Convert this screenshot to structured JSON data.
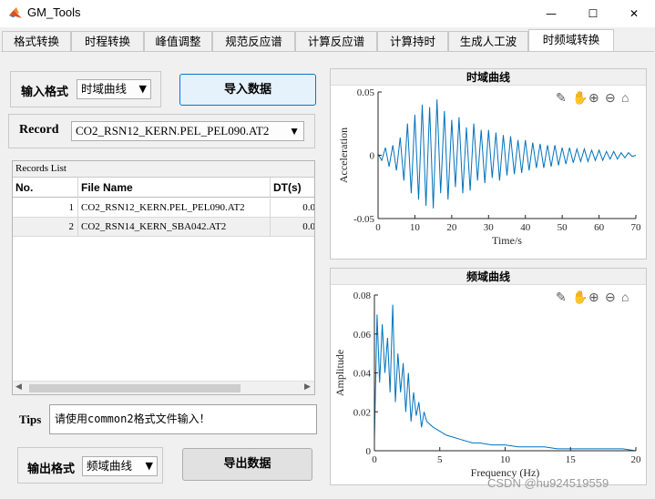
{
  "window": {
    "title": "GM_Tools",
    "controls": {
      "minimize": "—",
      "maximize": "☐",
      "close": "✕"
    }
  },
  "tabs": [
    {
      "label": "格式转换",
      "active": false
    },
    {
      "label": "时程转换",
      "active": false
    },
    {
      "label": "峰值调整",
      "active": false
    },
    {
      "label": "规范反应谱",
      "active": false
    },
    {
      "label": "计算反应谱",
      "active": false
    },
    {
      "label": "计算持时",
      "active": false
    },
    {
      "label": "生成人工波",
      "active": false
    },
    {
      "label": "时频域转换",
      "active": true
    }
  ],
  "left": {
    "input_format_label": "输入格式",
    "input_format_value": "时域曲线",
    "import_button": "导入数据",
    "record_label": "Record",
    "record_value": "CO2_RSN12_KERN.PEL_PEL090.AT2",
    "records_list_title": "Records List",
    "columns": [
      "No.",
      "File Name",
      "DT(s)"
    ],
    "rows": [
      {
        "no": "1",
        "file": "CO2_RSN12_KERN.PEL_PEL090.AT2",
        "dt": "0.0"
      },
      {
        "no": "2",
        "file": "CO2_RSN14_KERN_SBA042.AT2",
        "dt": "0.0"
      }
    ],
    "tips_label": "Tips",
    "tips_value": "请使用common2格式文件输入！",
    "output_format_label": "输出格式",
    "output_format_value": "频域曲线",
    "export_button": "导出数据"
  },
  "time_plot": {
    "panel_title": "时域曲线",
    "chart_data": {
      "type": "line",
      "xlabel": "Time/s",
      "ylabel": "Acceleration",
      "xlim": [
        0,
        70
      ],
      "ylim": [
        -0.05,
        0.05
      ],
      "xticks": [
        "0",
        "10",
        "20",
        "30",
        "40",
        "50",
        "60",
        "70"
      ],
      "yticks": [
        "-0.05",
        "0",
        "0.05"
      ],
      "series_color": "#0072bd",
      "x": [
        0,
        1,
        2,
        3,
        4,
        5,
        6,
        7,
        8,
        9,
        10,
        11,
        12,
        13,
        14,
        15,
        16,
        17,
        18,
        19,
        20,
        21,
        22,
        23,
        24,
        25,
        26,
        27,
        28,
        29,
        30,
        31,
        32,
        33,
        34,
        35,
        36,
        37,
        38,
        39,
        40,
        41,
        42,
        43,
        44,
        45,
        46,
        47,
        48,
        49,
        50,
        51,
        52,
        53,
        54,
        55,
        56,
        57,
        58,
        59,
        60,
        61,
        62,
        63,
        64,
        65,
        66,
        67,
        68,
        69,
        70
      ],
      "y": [
        0.001,
        -0.004,
        0.006,
        -0.009,
        0.008,
        -0.012,
        0.014,
        -0.02,
        0.025,
        -0.03,
        0.032,
        -0.035,
        0.04,
        -0.04,
        0.038,
        -0.042,
        0.044,
        -0.03,
        0.035,
        -0.035,
        0.028,
        -0.025,
        0.03,
        -0.03,
        0.022,
        -0.028,
        0.025,
        -0.02,
        0.02,
        -0.022,
        0.02,
        -0.018,
        0.018,
        -0.02,
        0.016,
        -0.016,
        0.015,
        -0.015,
        0.012,
        -0.014,
        0.012,
        -0.012,
        0.01,
        -0.01,
        0.009,
        -0.01,
        0.008,
        -0.009,
        0.008,
        -0.008,
        0.006,
        -0.007,
        0.006,
        -0.006,
        0.005,
        -0.005,
        0.005,
        -0.005,
        0.004,
        -0.004,
        0.004,
        -0.004,
        0.003,
        -0.003,
        0.003,
        -0.003,
        0.002,
        -0.002,
        0.002,
        -0.001,
        0.0
      ]
    }
  },
  "freq_plot": {
    "panel_title": "频域曲线",
    "chart_data": {
      "type": "line",
      "xlabel": "Frequency (Hz)",
      "ylabel": "Amplitude",
      "xlim": [
        0,
        20
      ],
      "ylim": [
        0,
        0.08
      ],
      "xticks": [
        "0",
        "5",
        "10",
        "15",
        "20"
      ],
      "yticks": [
        "0",
        "0.02",
        "0.04",
        "0.06",
        "0.08"
      ],
      "series_color": "#0072bd",
      "x": [
        0,
        0.2,
        0.4,
        0.6,
        0.8,
        1.0,
        1.2,
        1.4,
        1.6,
        1.8,
        2.0,
        2.2,
        2.4,
        2.6,
        2.8,
        3.0,
        3.2,
        3.4,
        3.6,
        3.8,
        4.0,
        4.5,
        5.0,
        5.5,
        6.0,
        6.5,
        7.0,
        7.5,
        8.0,
        9.0,
        10.0,
        11.0,
        12.0,
        13.0,
        14.0,
        15.0,
        16.0,
        17.0,
        18.0,
        19.0,
        20.0
      ],
      "y": [
        0.005,
        0.07,
        0.035,
        0.065,
        0.04,
        0.058,
        0.03,
        0.075,
        0.025,
        0.05,
        0.03,
        0.045,
        0.02,
        0.04,
        0.015,
        0.03,
        0.018,
        0.025,
        0.012,
        0.02,
        0.015,
        0.012,
        0.01,
        0.008,
        0.007,
        0.006,
        0.005,
        0.004,
        0.004,
        0.003,
        0.003,
        0.002,
        0.002,
        0.002,
        0.001,
        0.001,
        0.001,
        0.001,
        0.001,
        0.001,
        0.0
      ]
    }
  },
  "watermark": "CSDN @hu924519559",
  "colors": {
    "accent": "#0078d7",
    "line": "#0072bd",
    "active_tab": "#ffffff"
  },
  "toolbar_icons": [
    "edit-icon",
    "pan-icon",
    "zoom-in-icon",
    "zoom-out-icon",
    "home-icon"
  ]
}
